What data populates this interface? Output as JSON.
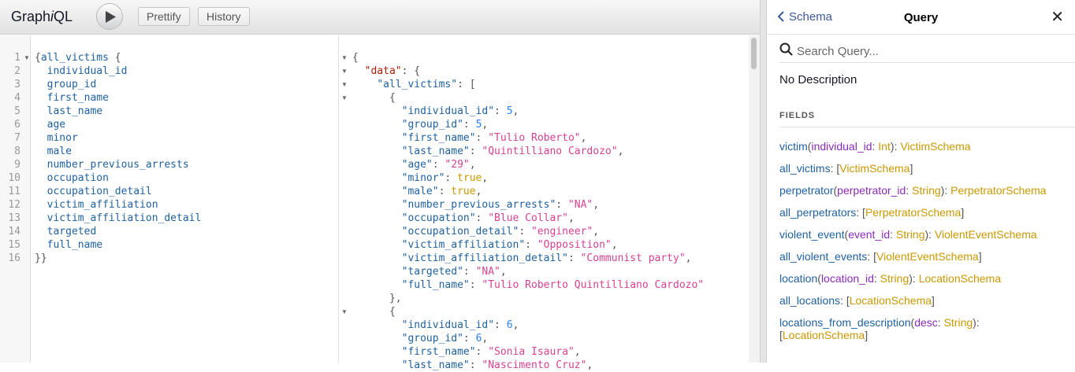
{
  "app": {
    "logo_pre": "Graph",
    "logo_i": "i",
    "logo_post": "QL"
  },
  "toolbar": {
    "run_icon": "play-icon",
    "prettify_label": "Prettify",
    "history_label": "History"
  },
  "query_lines": [
    {
      "num": "1",
      "fold": true,
      "text": "{all_victims {"
    },
    {
      "num": "2",
      "text": "  individual_id"
    },
    {
      "num": "3",
      "text": "  group_id"
    },
    {
      "num": "4",
      "text": "  first_name"
    },
    {
      "num": "5",
      "text": "  last_name"
    },
    {
      "num": "6",
      "text": "  age"
    },
    {
      "num": "7",
      "text": "  minor"
    },
    {
      "num": "8",
      "text": "  male"
    },
    {
      "num": "9",
      "text": "  number_previous_arrests"
    },
    {
      "num": "10",
      "text": "  occupation"
    },
    {
      "num": "11",
      "text": "  occupation_detail"
    },
    {
      "num": "12",
      "text": "  victim_affiliation"
    },
    {
      "num": "13",
      "text": "  victim_affiliation_detail"
    },
    {
      "num": "14",
      "text": "  targeted"
    },
    {
      "num": "15",
      "text": "  full_name"
    },
    {
      "num": "16",
      "text": "}}"
    }
  ],
  "result_lines": [
    {
      "fold": true,
      "parts": [
        [
          "p",
          "{"
        ]
      ]
    },
    {
      "fold": true,
      "parts": [
        [
          "p",
          "  "
        ],
        [
          "jdata",
          "\"data\""
        ],
        [
          "p",
          ": {"
        ]
      ]
    },
    {
      "fold": true,
      "parts": [
        [
          "p",
          "    "
        ],
        [
          "jk",
          "\"all_victims\""
        ],
        [
          "p",
          ": ["
        ]
      ]
    },
    {
      "fold": true,
      "parts": [
        [
          "p",
          "      {"
        ]
      ]
    },
    {
      "parts": [
        [
          "p",
          "        "
        ],
        [
          "jk",
          "\"individual_id\""
        ],
        [
          "p",
          ": "
        ],
        [
          "jn",
          "5"
        ],
        [
          "p",
          ","
        ]
      ]
    },
    {
      "parts": [
        [
          "p",
          "        "
        ],
        [
          "jk",
          "\"group_id\""
        ],
        [
          "p",
          ": "
        ],
        [
          "jn",
          "5"
        ],
        [
          "p",
          ","
        ]
      ]
    },
    {
      "parts": [
        [
          "p",
          "        "
        ],
        [
          "jk",
          "\"first_name\""
        ],
        [
          "p",
          ": "
        ],
        [
          "js",
          "\"Tulio Roberto\""
        ],
        [
          "p",
          ","
        ]
      ]
    },
    {
      "parts": [
        [
          "p",
          "        "
        ],
        [
          "jk",
          "\"last_name\""
        ],
        [
          "p",
          ": "
        ],
        [
          "js",
          "\"Quintilliano Cardozo\""
        ],
        [
          "p",
          ","
        ]
      ]
    },
    {
      "parts": [
        [
          "p",
          "        "
        ],
        [
          "jk",
          "\"age\""
        ],
        [
          "p",
          ": "
        ],
        [
          "js",
          "\"29\""
        ],
        [
          "p",
          ","
        ]
      ]
    },
    {
      "parts": [
        [
          "p",
          "        "
        ],
        [
          "jk",
          "\"minor\""
        ],
        [
          "p",
          ": "
        ],
        [
          "jb",
          "true"
        ],
        [
          "p",
          ","
        ]
      ]
    },
    {
      "parts": [
        [
          "p",
          "        "
        ],
        [
          "jk",
          "\"male\""
        ],
        [
          "p",
          ": "
        ],
        [
          "jb",
          "true"
        ],
        [
          "p",
          ","
        ]
      ]
    },
    {
      "parts": [
        [
          "p",
          "        "
        ],
        [
          "jk",
          "\"number_previous_arrests\""
        ],
        [
          "p",
          ": "
        ],
        [
          "js",
          "\"NA\""
        ],
        [
          "p",
          ","
        ]
      ]
    },
    {
      "parts": [
        [
          "p",
          "        "
        ],
        [
          "jk",
          "\"occupation\""
        ],
        [
          "p",
          ": "
        ],
        [
          "js",
          "\"Blue Collar\""
        ],
        [
          "p",
          ","
        ]
      ]
    },
    {
      "parts": [
        [
          "p",
          "        "
        ],
        [
          "jk",
          "\"occupation_detail\""
        ],
        [
          "p",
          ": "
        ],
        [
          "js",
          "\"engineer\""
        ],
        [
          "p",
          ","
        ]
      ]
    },
    {
      "parts": [
        [
          "p",
          "        "
        ],
        [
          "jk",
          "\"victim_affiliation\""
        ],
        [
          "p",
          ": "
        ],
        [
          "js",
          "\"Opposition\""
        ],
        [
          "p",
          ","
        ]
      ]
    },
    {
      "parts": [
        [
          "p",
          "        "
        ],
        [
          "jk",
          "\"victim_affiliation_detail\""
        ],
        [
          "p",
          ": "
        ],
        [
          "js",
          "\"Communist party\""
        ],
        [
          "p",
          ","
        ]
      ]
    },
    {
      "parts": [
        [
          "p",
          "        "
        ],
        [
          "jk",
          "\"targeted\""
        ],
        [
          "p",
          ": "
        ],
        [
          "js",
          "\"NA\""
        ],
        [
          "p",
          ","
        ]
      ]
    },
    {
      "parts": [
        [
          "p",
          "        "
        ],
        [
          "jk",
          "\"full_name\""
        ],
        [
          "p",
          ": "
        ],
        [
          "js",
          "\"Tulio Roberto Quintilliano Cardozo\""
        ]
      ]
    },
    {
      "parts": [
        [
          "p",
          "      },"
        ]
      ]
    },
    {
      "fold": true,
      "parts": [
        [
          "p",
          "      {"
        ]
      ]
    },
    {
      "parts": [
        [
          "p",
          "        "
        ],
        [
          "jk",
          "\"individual_id\""
        ],
        [
          "p",
          ": "
        ],
        [
          "jn",
          "6"
        ],
        [
          "p",
          ","
        ]
      ]
    },
    {
      "parts": [
        [
          "p",
          "        "
        ],
        [
          "jk",
          "\"group_id\""
        ],
        [
          "p",
          ": "
        ],
        [
          "jn",
          "6"
        ],
        [
          "p",
          ","
        ]
      ]
    },
    {
      "parts": [
        [
          "p",
          "        "
        ],
        [
          "jk",
          "\"first_name\""
        ],
        [
          "p",
          ": "
        ],
        [
          "js",
          "\"Sonia Isaura\""
        ],
        [
          "p",
          ","
        ]
      ]
    },
    {
      "parts": [
        [
          "p",
          "        "
        ],
        [
          "jk",
          "\"last_name\""
        ],
        [
          "p",
          ": "
        ],
        [
          "js",
          "\"Nascimento Cruz\""
        ],
        [
          "p",
          ","
        ]
      ]
    }
  ],
  "docs": {
    "back_label": "Schema",
    "title": "Query",
    "close_icon": "close-icon",
    "search_placeholder": "Search Query...",
    "no_description": "No Description",
    "fields_heading": "FIELDS",
    "fields": [
      [
        [
          "fn",
          "victim"
        ],
        [
          "pu",
          "("
        ],
        [
          "arg",
          "individual_id"
        ],
        [
          "pu",
          ": "
        ],
        [
          "ty",
          "Int"
        ],
        [
          "pu",
          "): "
        ],
        [
          "ty",
          "VictimSchema"
        ]
      ],
      [
        [
          "fn",
          "all_victims"
        ],
        [
          "pu",
          ": ["
        ],
        [
          "ty",
          "VictimSchema"
        ],
        [
          "pu",
          "]"
        ]
      ],
      [
        [
          "fn",
          "perpetrator"
        ],
        [
          "pu",
          "("
        ],
        [
          "arg",
          "perpetrator_id"
        ],
        [
          "pu",
          ": "
        ],
        [
          "ty",
          "String"
        ],
        [
          "pu",
          "): "
        ],
        [
          "ty",
          "PerpetratorSchema"
        ]
      ],
      [
        [
          "fn",
          "all_perpetrators"
        ],
        [
          "pu",
          ": ["
        ],
        [
          "ty",
          "PerpetratorSchema"
        ],
        [
          "pu",
          "]"
        ]
      ],
      [
        [
          "fn",
          "violent_event"
        ],
        [
          "pu",
          "("
        ],
        [
          "arg",
          "event_id"
        ],
        [
          "pu",
          ": "
        ],
        [
          "ty",
          "String"
        ],
        [
          "pu",
          "): "
        ],
        [
          "ty",
          "ViolentEventSchema"
        ]
      ],
      [
        [
          "fn",
          "all_violent_events"
        ],
        [
          "pu",
          ": ["
        ],
        [
          "ty",
          "ViolentEventSchema"
        ],
        [
          "pu",
          "]"
        ]
      ],
      [
        [
          "fn",
          "location"
        ],
        [
          "pu",
          "("
        ],
        [
          "arg",
          "location_id"
        ],
        [
          "pu",
          ": "
        ],
        [
          "ty",
          "String"
        ],
        [
          "pu",
          "): "
        ],
        [
          "ty",
          "LocationSchema"
        ]
      ],
      [
        [
          "fn",
          "all_locations"
        ],
        [
          "pu",
          ": ["
        ],
        [
          "ty",
          "LocationSchema"
        ],
        [
          "pu",
          "]"
        ]
      ],
      [
        [
          "fn",
          "locations_from_description"
        ],
        [
          "pu",
          "("
        ],
        [
          "arg",
          "desc"
        ],
        [
          "pu",
          ": "
        ],
        [
          "ty",
          "String"
        ],
        [
          "pu",
          "):"
        ],
        [
          "br",
          ""
        ],
        [
          "pu",
          "["
        ],
        [
          "ty",
          "LocationSchema"
        ],
        [
          "pu",
          "]"
        ]
      ]
    ]
  }
}
